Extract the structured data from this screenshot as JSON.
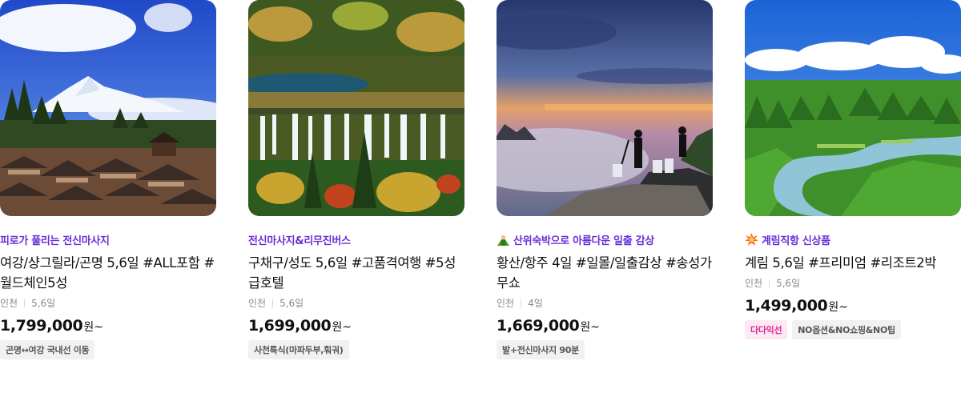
{
  "cards": [
    {
      "image_alt": "Snow mountain over Lijiang old town",
      "promo": "피로가 풀리는 전신마사지",
      "promo_icon": "",
      "title": "여강/샹그릴라/곤명 5,6일 #ALL포함 #월드체인5성",
      "meta": [
        "인천",
        "5,6일"
      ],
      "price": "1,799,000",
      "price_unit": "원~",
      "tags": [
        {
          "label": "곤명↔여강 국내선 이동",
          "style": "gray"
        }
      ]
    },
    {
      "image_alt": "Jiuzhaigou waterfall",
      "promo": "전신마사지&리무진버스",
      "promo_icon": "",
      "title": "구채구/성도 5,6일 #고품격여행 #5성급호텔",
      "meta": [
        "인천",
        "5,6일"
      ],
      "price": "1,699,000",
      "price_unit": "원~",
      "tags": [
        {
          "label": "사천특식(마파두부,훠궈)",
          "style": "gray"
        }
      ]
    },
    {
      "image_alt": "Sunset on Huangshan peaks",
      "promo": "산위숙박으로 아름다운 일출 감상",
      "promo_icon": "mountain-person-icon",
      "title": "황산/항주 4일 #일몰/일출감상 #송성가무쇼",
      "meta": [
        "인천",
        "4일"
      ],
      "price": "1,669,000",
      "price_unit": "원~",
      "tags": [
        {
          "label": "발+전신마사지 90분",
          "style": "gray"
        }
      ]
    },
    {
      "image_alt": "Guilin Li River karst landscape",
      "promo": "계림직항 신상품",
      "promo_icon": "collision-icon",
      "title": "계림 5,6일 #프리미엄 #리조트2박",
      "meta": [
        "인천",
        "5,6일"
      ],
      "price": "1,499,000",
      "price_unit": "원~",
      "tags": [
        {
          "label": "다다익선",
          "style": "pink"
        },
        {
          "label": "NO옵션&NO쇼핑&NO팁",
          "style": "gray"
        }
      ]
    }
  ]
}
